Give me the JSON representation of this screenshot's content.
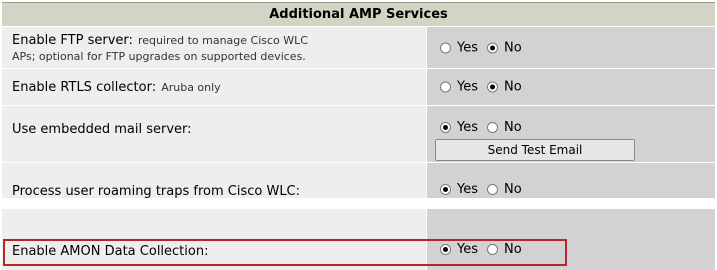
{
  "section": {
    "title": "Additional AMP Services"
  },
  "rows": [
    {
      "label": "Enable FTP server:",
      "note": "required to manage Cisco WLC",
      "note2": "APs; optional for FTP upgrades on supported devices.",
      "yes": "Yes",
      "no": "No",
      "selected": "No"
    },
    {
      "label": "Enable RTLS collector:",
      "note": "Aruba only",
      "yes": "Yes",
      "no": "No",
      "selected": "No"
    },
    {
      "label": "Use embedded mail server:",
      "yes": "Yes",
      "no": "No",
      "selected": "Yes"
    },
    {
      "button": "Send Test Email"
    },
    {
      "label": "Process user roaming traps from Cisco WLC:",
      "yes": "Yes",
      "no": "No",
      "selected": "Yes"
    },
    {
      "label": "Enable AMON Data Collection:",
      "yes": "Yes",
      "no": "No",
      "selected": "Yes",
      "highlighted": true
    }
  ],
  "colors": {
    "highlight": "#b4252c",
    "header_bg": "#d3d3c6",
    "label_bg": "#eeeeee",
    "value_bg": "#d2d2d2"
  }
}
